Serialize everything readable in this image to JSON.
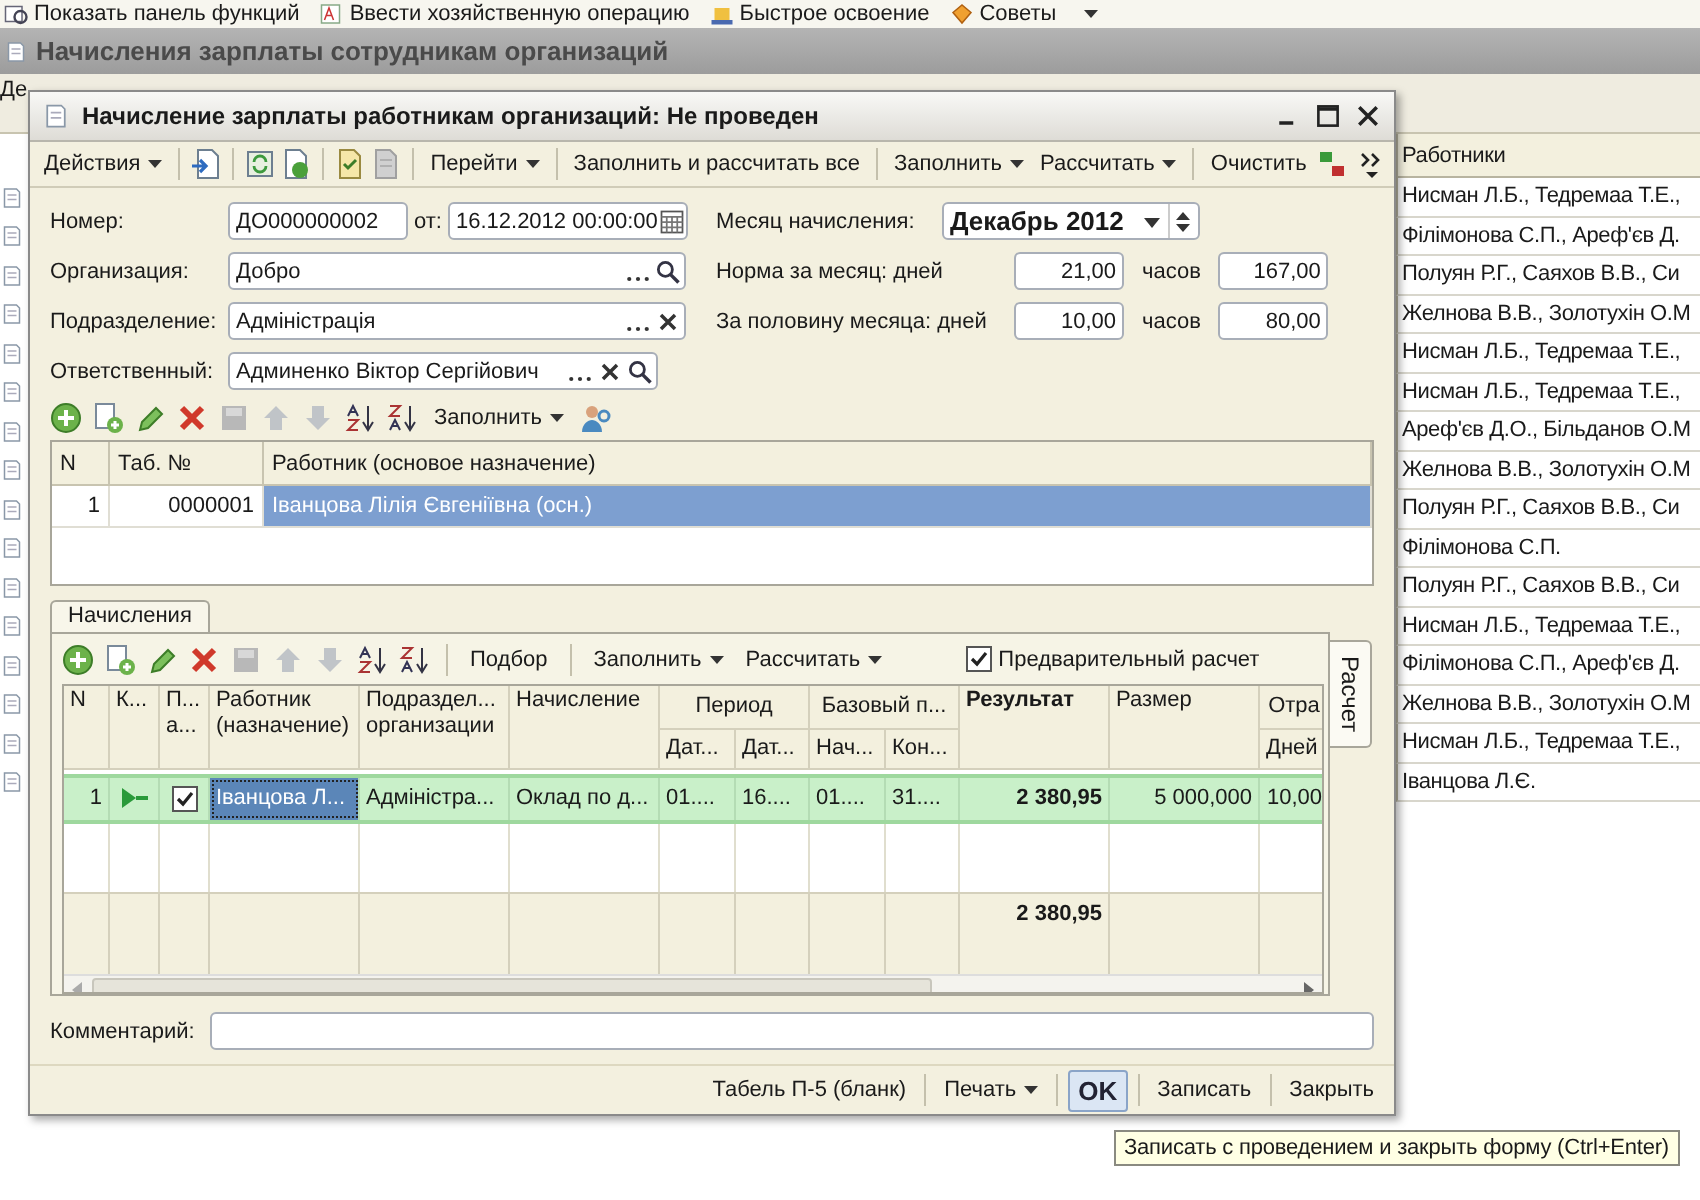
{
  "app_toolbar": [
    {
      "label": "Показать панель функций"
    },
    {
      "label": "Ввести хозяйственную операцию"
    },
    {
      "label": "Быстрое освоение"
    },
    {
      "label": "Советы"
    }
  ],
  "list_window": {
    "title": "Начисления зарплаты сотрудникам организаций",
    "actions_label": "Де",
    "column_header": "Работники",
    "rows": [
      "Нисман Л.Б., Тедремаа Т.Е.,",
      "Філімонова С.П., Ареф'єв Д.",
      "Полуян Р.Г., Саяхов В.В., Си",
      "Желнова В.В., Золотухін О.М",
      "Нисман Л.Б., Тедремаа Т.Е.,",
      "Нисман Л.Б., Тедремаа Т.Е.,",
      "Ареф'єв Д.О., Більданов О.М",
      "Желнова В.В., Золотухін О.М",
      "Полуян Р.Г., Саяхов В.В., Си",
      "Філімонова С.П.",
      "Полуян Р.Г., Саяхов В.В., Си",
      "Нисман Л.Б., Тедремаа Т.Е.,",
      "Філімонова С.П., Ареф'єв Д.",
      "Желнова В.В., Золотухін О.М",
      "Нисман Л.Б., Тедремаа Т.Е.,",
      "Іванцова Л.Є."
    ]
  },
  "dialog": {
    "title": "Начисление зарплаты работникам организаций: Не проведен",
    "toolbar": [
      {
        "label": "Действия",
        "kind": "menu"
      },
      {
        "label": "Перейти",
        "kind": "menu"
      },
      {
        "label": "Заполнить и рассчитать все",
        "kind": "button"
      },
      {
        "label": "Заполнить",
        "kind": "menu"
      },
      {
        "label": "Рассчитать",
        "kind": "menu"
      },
      {
        "label": "Очистить",
        "kind": "button"
      }
    ],
    "number": {
      "label": "Номер:",
      "value": "ДО000000002"
    },
    "date": {
      "label": "от:",
      "value": "16.12.2012 00:00:00"
    },
    "organization": {
      "label": "Организация:",
      "value": "Добро"
    },
    "department": {
      "label": "Подразделение:",
      "value": "Адміністрація"
    },
    "responsible": {
      "label": "Ответственный:",
      "value": "Админенко Віктор Сергійович"
    },
    "month": {
      "label": "Месяц начисления:",
      "value": "Декабрь 2012"
    },
    "norms": [
      {
        "label": "Норма за месяц: дней",
        "days": "21,00",
        "hours_label": "часов",
        "hours": "167,00"
      },
      {
        "label": "За половину месяца: дней",
        "days": "10,00",
        "hours_label": "часов",
        "hours": "80,00"
      }
    ],
    "workers": {
      "toolbar": [
        {
          "label": "Заполнить",
          "kind": "menu"
        }
      ],
      "columns": [
        "N",
        "Таб. №",
        "Работник (основое назначение)"
      ],
      "rows": [
        {
          "n": "1",
          "tab_no": "0000001",
          "name": "Іванцова Лілія Євгеніївна (осн.)",
          "selected": true
        }
      ]
    },
    "tabs": [
      {
        "label": "Начисления",
        "selected": true
      }
    ],
    "side_tab": "Расчет",
    "accruals": {
      "toolbar": [
        {
          "label": "Подбор",
          "kind": "button"
        },
        {
          "label": "Заполнить",
          "kind": "menu"
        },
        {
          "label": "Рассчитать",
          "kind": "menu"
        }
      ],
      "preliminary": {
        "label": "Предварительный расчет",
        "checked": true
      },
      "columns": [
        {
          "label": "N"
        },
        {
          "label": "К..."
        },
        {
          "label": "П... а..."
        },
        {
          "label": "Работник (назначение)"
        },
        {
          "label": "Подраздел... организации"
        },
        {
          "label": "Начисление"
        },
        {
          "label": "Дат...",
          "group": "Период"
        },
        {
          "label": "Дат...",
          "group_continues": true
        },
        {
          "label": "Нач...",
          "group": "Базовый п..."
        },
        {
          "label": "Кон...",
          "group_continues": true
        },
        {
          "label": "Результат",
          "kind": "bold"
        },
        {
          "label": "Размер"
        },
        {
          "label": "Дней",
          "group": "Отра"
        }
      ],
      "rows": [
        {
          "selected": true,
          "cells": [
            {
              "kind": "text",
              "text": "1"
            },
            {
              "kind": "icon"
            },
            {
              "kind": "check",
              "checked": true
            },
            {
              "kind": "current",
              "text": "Іванцова Л..."
            },
            {
              "kind": "text",
              "text": "Адміністра..."
            },
            {
              "kind": "text",
              "text": "Оклад по д..."
            },
            {
              "kind": "text",
              "text": "01...."
            },
            {
              "kind": "text",
              "text": "16...."
            },
            {
              "kind": "text",
              "text": "01...."
            },
            {
              "kind": "text",
              "text": "31...."
            },
            {
              "kind": "bold",
              "text": "2 380,95"
            },
            {
              "kind": "text",
              "text": "5 000,000"
            },
            {
              "kind": "text",
              "text": "10,00"
            }
          ]
        }
      ],
      "total": "2 380,95"
    },
    "comment": {
      "label": "Комментарий:"
    },
    "buttons": [
      {
        "label": "Табель П-5 (бланк)",
        "kind": "button"
      },
      {
        "label": "Печать",
        "kind": "menu"
      },
      {
        "label": "OK",
        "kind": "default"
      },
      {
        "label": "Записать",
        "kind": "button"
      },
      {
        "label": "Закрыть",
        "kind": "button"
      }
    ]
  },
  "tooltip": "Записать с проведением и закрыть форму (Ctrl+Enter)"
}
